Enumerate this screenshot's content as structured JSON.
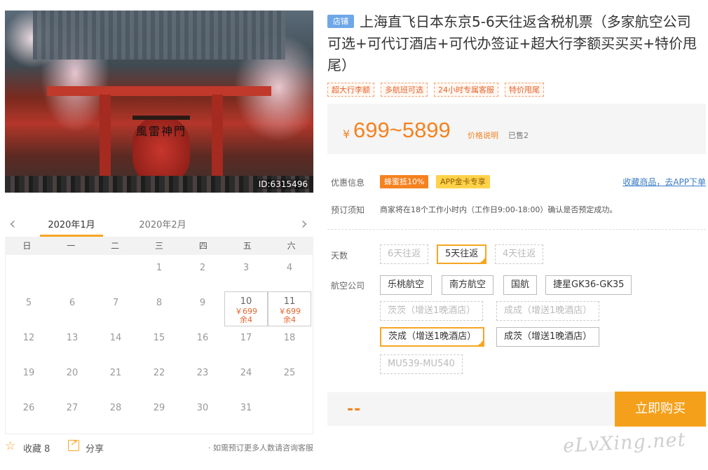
{
  "hero": {
    "image_id": "ID:6315496",
    "lantern_text": "風雷神門"
  },
  "calendar": {
    "months": [
      "2020年1月",
      "2020年2月"
    ],
    "weekdays": [
      "日",
      "一",
      "二",
      "三",
      "四",
      "五",
      "六"
    ],
    "days": [
      {
        "d": "1"
      },
      {
        "d": "2"
      },
      {
        "d": "3"
      },
      {
        "d": "4"
      },
      {
        "d": "5"
      },
      {
        "d": "6"
      },
      {
        "d": "7"
      },
      {
        "d": "8"
      },
      {
        "d": "9"
      },
      {
        "d": "10",
        "price": "￥699",
        "remain": "余4"
      },
      {
        "d": "11",
        "price": "￥699",
        "remain": "余4"
      },
      {
        "d": "12"
      },
      {
        "d": "13"
      },
      {
        "d": "14"
      },
      {
        "d": "15"
      },
      {
        "d": "16"
      },
      {
        "d": "17"
      },
      {
        "d": "18"
      },
      {
        "d": "19"
      },
      {
        "d": "20"
      },
      {
        "d": "21"
      },
      {
        "d": "22"
      },
      {
        "d": "23"
      },
      {
        "d": "24"
      },
      {
        "d": "25"
      },
      {
        "d": "26"
      },
      {
        "d": "27"
      },
      {
        "d": "28"
      },
      {
        "d": "29"
      },
      {
        "d": "30"
      },
      {
        "d": "31"
      }
    ]
  },
  "footer": {
    "fav_label": "收藏 8",
    "share_label": "分享",
    "note": "· 如需预订更多人数请咨询客服"
  },
  "product": {
    "store_tag": "店铺",
    "title": "上海直飞日本东京5-6天往返含税机票（多家航空公司可选+可代订酒店+可代办签证+超大行李额买买买+特价甩尾）",
    "tags": [
      "超大行李额",
      "多航班可选",
      "24小时专属客服",
      "特价甩尾"
    ],
    "price_symbol": "¥",
    "price_range": "699~5899",
    "price_note": "价格说明",
    "sold": "已售2"
  },
  "promo": {
    "label": "优惠信息",
    "badges": [
      "蜂蜜抵10%",
      "APP金卡专享"
    ],
    "fav_link": "收藏商品，去APP下单"
  },
  "booking": {
    "label": "预订须知",
    "text": "商家将在18个工作小时内（工作日9:00-18:00）确认是否预定成功。"
  },
  "options": {
    "days_label": "天数",
    "days": [
      {
        "label": "6天往返",
        "state": "disabled"
      },
      {
        "label": "5天往返",
        "state": "selected"
      },
      {
        "label": "4天往返",
        "state": "disabled"
      }
    ],
    "airline_label": "航空公司",
    "airlines": [
      {
        "label": "乐桃航空",
        "state": "normal"
      },
      {
        "label": "南方航空",
        "state": "normal"
      },
      {
        "label": "国航",
        "state": "normal"
      },
      {
        "label": "捷星GK36-GK35",
        "state": "normal"
      },
      {
        "label": "茨茨（增送1晚酒店）",
        "state": "disabled"
      },
      {
        "label": "成成（增送1晚酒店）",
        "state": "disabled"
      },
      {
        "label": "茨成（增送1晚酒店）",
        "state": "selected"
      },
      {
        "label": "成茨（增送1晚酒店）",
        "state": "normal"
      },
      {
        "label": "MU539-MU540",
        "state": "disabled"
      }
    ]
  },
  "buy": {
    "total": "--",
    "button": "立即购买"
  },
  "watermark": "eLvXing.net",
  "colors": {
    "accent": "#f5a623",
    "price": "#f5821f",
    "link": "#3a7cc4",
    "store_tag": "#6fa8e8"
  }
}
